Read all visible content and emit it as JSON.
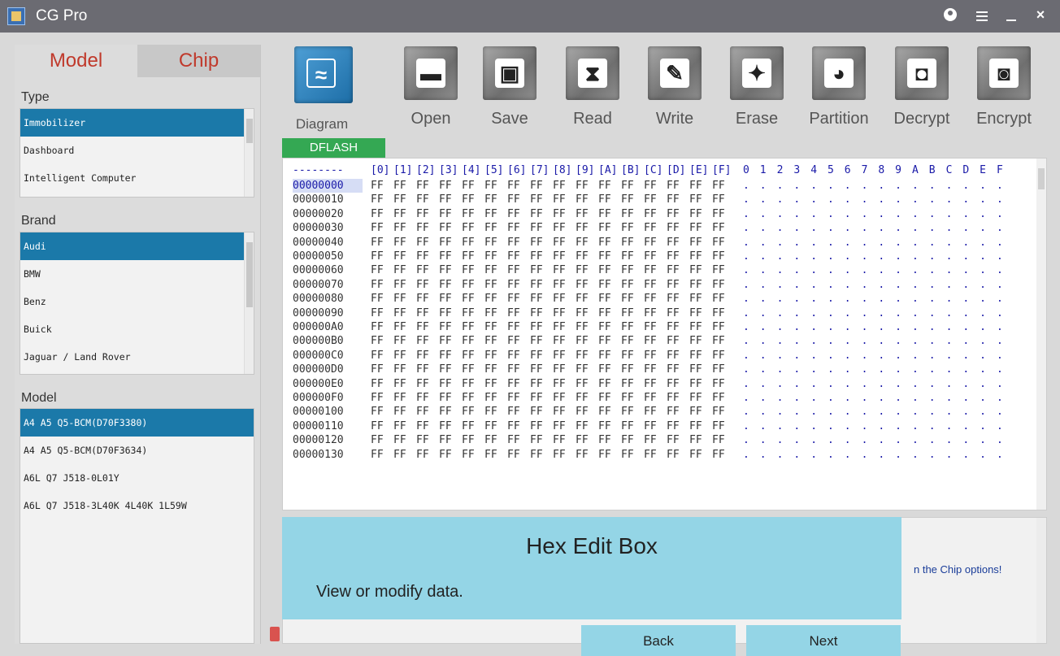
{
  "app": {
    "title": "CG Pro"
  },
  "left": {
    "tabs": [
      "Model",
      "Chip"
    ],
    "type_label": "Type",
    "types": [
      "Immobilizer",
      "Dashboard",
      "Intelligent Computer"
    ],
    "brand_label": "Brand",
    "brands": [
      "Audi",
      "BMW",
      "Benz",
      "Buick",
      "Jaguar / Land Rover"
    ],
    "model_label": "Model",
    "models": [
      "A4 A5 Q5-BCM(D70F3380)",
      "A4 A5 Q5-BCM(D70F3634)",
      "A6L Q7 J518-0L01Y",
      "A6L Q7 J518-3L40K 4L40K 1L59W"
    ],
    "selected": {
      "type": 0,
      "brand": 0,
      "model": 0
    }
  },
  "toolbar": {
    "diagram": "Diagram",
    "open": "Open",
    "save": "Save",
    "read": "Read",
    "write": "Write",
    "erase": "Erase",
    "partition": "Partition",
    "decrypt": "Decrypt",
    "encrypt": "Encrypt"
  },
  "memory_tab": "DFLASH",
  "hex": {
    "header_dashes": "--------",
    "header_cols": [
      "[0]",
      "[1]",
      "[2]",
      "[3]",
      "[4]",
      "[5]",
      "[6]",
      "[7]",
      "[8]",
      "[9]",
      "[A]",
      "[B]",
      "[C]",
      "[D]",
      "[E]",
      "[F]"
    ],
    "ascii_header": [
      "0",
      "1",
      "2",
      "3",
      "4",
      "5",
      "6",
      "7",
      "8",
      "9",
      "A",
      "B",
      "C",
      "D",
      "E",
      "F"
    ],
    "addresses": [
      "00000000",
      "00000010",
      "00000020",
      "00000030",
      "00000040",
      "00000050",
      "00000060",
      "00000070",
      "00000080",
      "00000090",
      "000000A0",
      "000000B0",
      "000000C0",
      "000000D0",
      "000000E0",
      "000000F0",
      "00000100",
      "00000110",
      "00000120",
      "00000130"
    ],
    "fill_byte": "FF",
    "ascii_char": ".",
    "selected_row": 0
  },
  "log": {
    "text": "n the Chip options!"
  },
  "tip": {
    "title": "Hex Edit Box",
    "body": "View or modify data.",
    "back": "Back",
    "next": "Next"
  }
}
